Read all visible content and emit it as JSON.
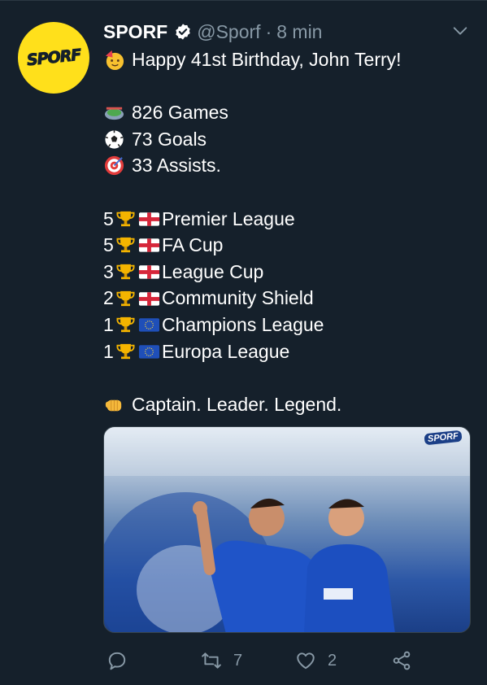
{
  "account": {
    "avatar_text": "SPORF",
    "display_name": "SPORF",
    "handle": "@Sporf",
    "separator": "·",
    "time": "8 min"
  },
  "tweet": {
    "greeting": "Happy 41st Birthday, John Terry!",
    "stats": [
      {
        "icon": "stadium-icon",
        "text": "826 Games"
      },
      {
        "icon": "soccer-ball-icon",
        "text": "73 Goals"
      },
      {
        "icon": "target-icon",
        "text": "33 Assists."
      }
    ],
    "trophies": [
      {
        "count": "5",
        "flag": "england-flag-icon",
        "name": "Premier League"
      },
      {
        "count": "5",
        "flag": "england-flag-icon",
        "name": "FA Cup"
      },
      {
        "count": "3",
        "flag": "england-flag-icon",
        "name": "League Cup"
      },
      {
        "count": "2",
        "flag": "england-flag-icon",
        "name": "Community Shield"
      },
      {
        "count": "1",
        "flag": "eu-flag-icon",
        "name": "Champions League"
      },
      {
        "count": "1",
        "flag": "eu-flag-icon",
        "name": "Europa League"
      }
    ],
    "closing": "Captain. Leader. Legend.",
    "media_watermark": "SPORF"
  },
  "actions": {
    "reply_count": "",
    "retweet_count": "7",
    "like_count": "2"
  },
  "colors": {
    "background": "#15202b",
    "secondary_text": "#8899a6",
    "verified": "#ffffff",
    "avatar_bg": "#ffe01b"
  }
}
